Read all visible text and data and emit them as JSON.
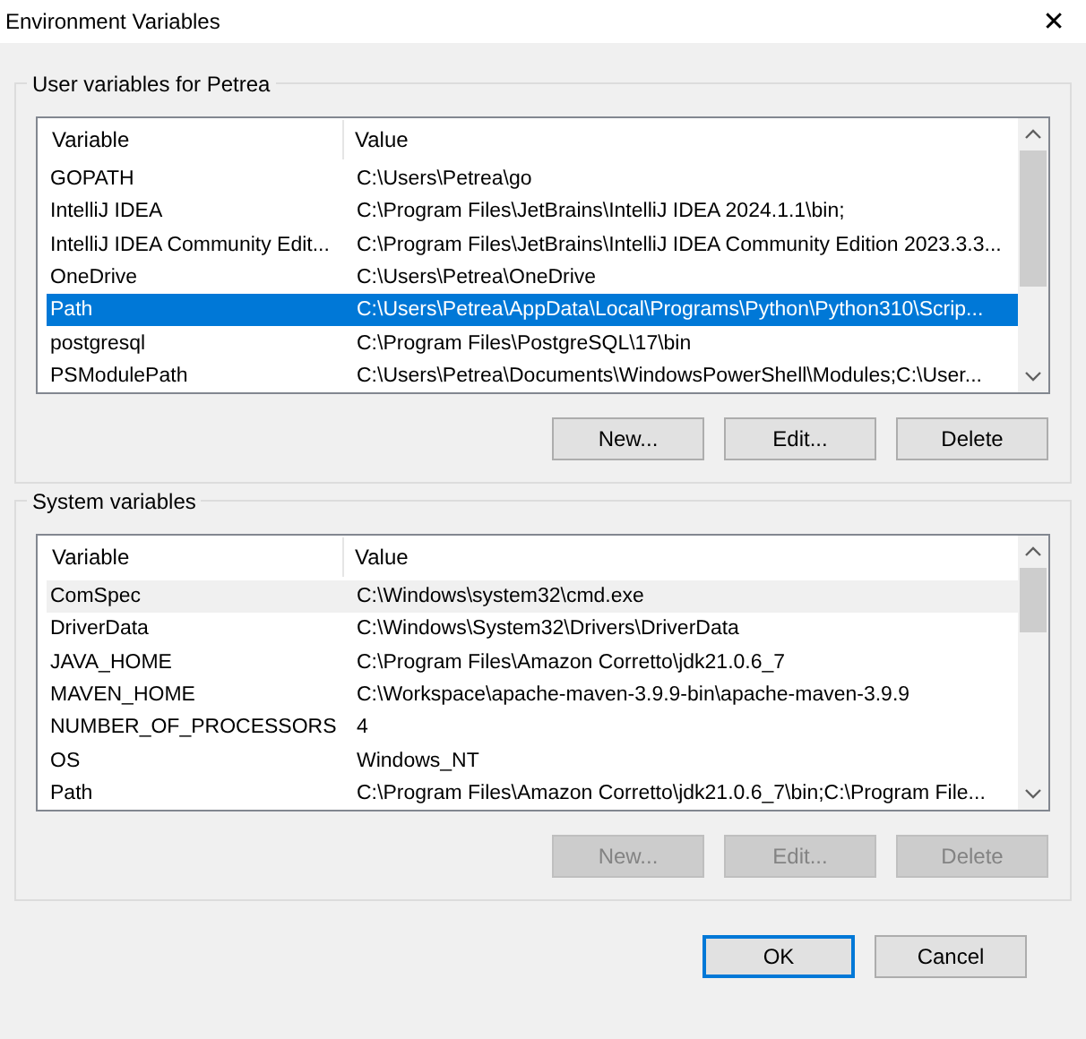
{
  "window": {
    "title": "Environment Variables",
    "close": "✕"
  },
  "groups": [
    {
      "title": "User variables for Petrea",
      "focused": true,
      "columns": [
        "Variable",
        "Value"
      ],
      "rows": [
        {
          "variable": "GOPATH",
          "value": "C:\\Users\\Petrea\\go",
          "selected": false
        },
        {
          "variable": "IntelliJ IDEA",
          "value": "C:\\Program Files\\JetBrains\\IntelliJ IDEA 2024.1.1\\bin;",
          "selected": false
        },
        {
          "variable": "IntelliJ IDEA Community Edit...",
          "value": "C:\\Program Files\\JetBrains\\IntelliJ IDEA Community Edition 2023.3.3...",
          "selected": false
        },
        {
          "variable": "OneDrive",
          "value": "C:\\Users\\Petrea\\OneDrive",
          "selected": false
        },
        {
          "variable": "Path",
          "value": "C:\\Users\\Petrea\\AppData\\Local\\Programs\\Python\\Python310\\Scrip...",
          "selected": true
        },
        {
          "variable": "postgresql",
          "value": "C:\\Program Files\\PostgreSQL\\17\\bin",
          "selected": false
        },
        {
          "variable": "PSModulePath",
          "value": "C:\\Users\\Petrea\\Documents\\WindowsPowerShell\\Modules;C:\\User...",
          "selected": false
        }
      ],
      "buttons": [
        {
          "label": "New...",
          "disabled": false
        },
        {
          "label": "Edit...",
          "disabled": false
        },
        {
          "label": "Delete",
          "disabled": false
        }
      ]
    },
    {
      "title": "System variables",
      "focused": false,
      "columns": [
        "Variable",
        "Value"
      ],
      "rows": [
        {
          "variable": "ComSpec",
          "value": "C:\\Windows\\system32\\cmd.exe",
          "selected": true
        },
        {
          "variable": "DriverData",
          "value": "C:\\Windows\\System32\\Drivers\\DriverData",
          "selected": false
        },
        {
          "variable": "JAVA_HOME",
          "value": "C:\\Program Files\\Amazon Corretto\\jdk21.0.6_7",
          "selected": false
        },
        {
          "variable": "MAVEN_HOME",
          "value": "C:\\Workspace\\apache-maven-3.9.9-bin\\apache-maven-3.9.9",
          "selected": false
        },
        {
          "variable": "NUMBER_OF_PROCESSORS",
          "value": "4",
          "selected": false
        },
        {
          "variable": "OS",
          "value": "Windows_NT",
          "selected": false
        },
        {
          "variable": "Path",
          "value": "C:\\Program Files\\Amazon Corretto\\jdk21.0.6_7\\bin;C:\\Program File...",
          "selected": false
        }
      ],
      "buttons": [
        {
          "label": "New...",
          "disabled": true
        },
        {
          "label": "Edit...",
          "disabled": true
        },
        {
          "label": "Delete",
          "disabled": true
        }
      ]
    }
  ],
  "footer_buttons": [
    {
      "label": "OK",
      "default": true
    },
    {
      "label": "Cancel",
      "default": false
    }
  ]
}
